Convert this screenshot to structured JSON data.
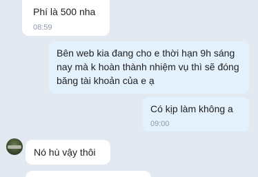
{
  "messages": [
    {
      "direction": "incoming",
      "text": "Phí là 500 nha",
      "time": "08:59"
    },
    {
      "direction": "outgoing",
      "text": "Bên web kia đang cho e thời hạn 9h sáng nay mà k hoàn thành nhiệm vụ thì sẽ đóng băng tài khoản của e ạ"
    },
    {
      "direction": "outgoing",
      "text": "Có kịp làm không a",
      "time": "09:00"
    },
    {
      "direction": "incoming",
      "text": "Nó hù vậy thôi"
    },
    {
      "direction": "incoming",
      "text": ""
    }
  ]
}
